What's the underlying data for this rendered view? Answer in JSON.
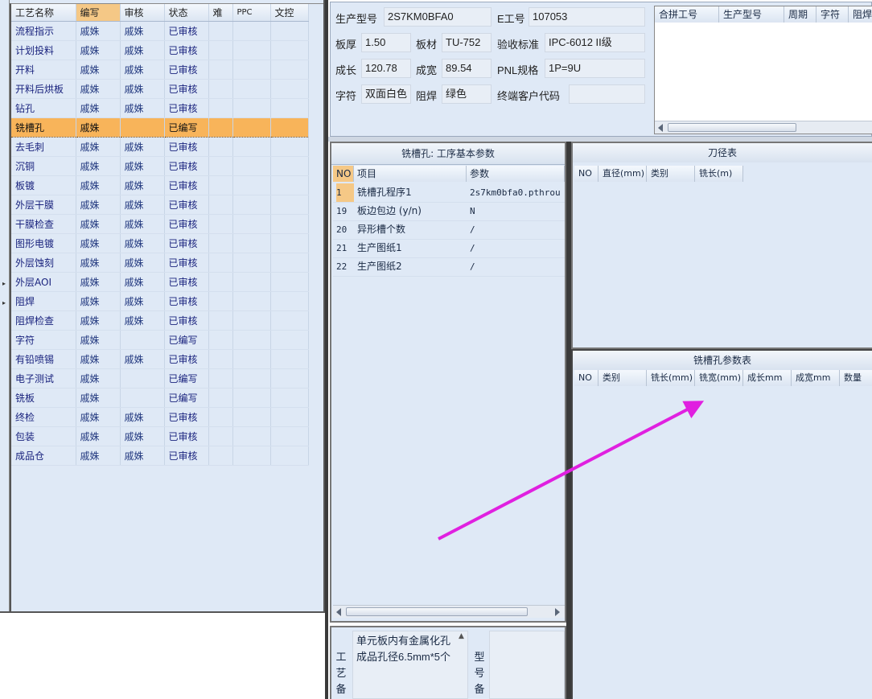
{
  "process_grid": {
    "columns": [
      "工艺名称",
      "编写",
      "审核",
      "状态",
      "难",
      "PPC",
      "文控"
    ],
    "rows": [
      {
        "name": "流程指示",
        "editor": "戚姝",
        "reviewer": "戚姝",
        "status": "已审核"
      },
      {
        "name": "计划投料",
        "editor": "戚姝",
        "reviewer": "戚姝",
        "status": "已审核"
      },
      {
        "name": "开料",
        "editor": "戚姝",
        "reviewer": "戚姝",
        "status": "已审核"
      },
      {
        "name": "开料后烘板",
        "editor": "戚姝",
        "reviewer": "戚姝",
        "status": "已审核"
      },
      {
        "name": "钻孔",
        "editor": "戚姝",
        "reviewer": "戚姝",
        "status": "已审核"
      },
      {
        "name": "铣槽孔",
        "editor": "戚姝",
        "reviewer": "",
        "status": "已编写"
      },
      {
        "name": "去毛刺",
        "editor": "戚姝",
        "reviewer": "戚姝",
        "status": "已审核"
      },
      {
        "name": "沉铜",
        "editor": "戚姝",
        "reviewer": "戚姝",
        "status": "已审核"
      },
      {
        "name": "板镀",
        "editor": "戚姝",
        "reviewer": "戚姝",
        "status": "已审核"
      },
      {
        "name": "外层干膜",
        "editor": "戚姝",
        "reviewer": "戚姝",
        "status": "已审核"
      },
      {
        "name": "干膜检查",
        "editor": "戚姝",
        "reviewer": "戚姝",
        "status": "已审核"
      },
      {
        "name": "图形电镀",
        "editor": "戚姝",
        "reviewer": "戚姝",
        "status": "已审核"
      },
      {
        "name": "外层蚀刻",
        "editor": "戚姝",
        "reviewer": "戚姝",
        "status": "已审核"
      },
      {
        "name": "外层AOI",
        "editor": "戚姝",
        "reviewer": "戚姝",
        "status": "已审核"
      },
      {
        "name": "阻焊",
        "editor": "戚姝",
        "reviewer": "戚姝",
        "status": "已审核"
      },
      {
        "name": "阻焊检查",
        "editor": "戚姝",
        "reviewer": "戚姝",
        "status": "已审核"
      },
      {
        "name": "字符",
        "editor": "戚姝",
        "reviewer": "",
        "status": "已编写"
      },
      {
        "name": "有铅喷锡",
        "editor": "戚姝",
        "reviewer": "戚姝",
        "status": "已审核"
      },
      {
        "name": "电子测试",
        "editor": "戚姝",
        "reviewer": "",
        "status": "已编写"
      },
      {
        "name": "铣板",
        "editor": "戚姝",
        "reviewer": "",
        "status": "已编写"
      },
      {
        "name": "终检",
        "editor": "戚姝",
        "reviewer": "戚姝",
        "status": "已审核"
      },
      {
        "name": "包装",
        "editor": "戚姝",
        "reviewer": "戚姝",
        "status": "已审核"
      },
      {
        "name": "成品仓",
        "editor": "戚姝",
        "reviewer": "戚姝",
        "status": "已审核"
      }
    ]
  },
  "info": {
    "model_label": "生产型号",
    "model_value": "2S7KM0BFA0",
    "eno_label": "E工号",
    "eno_value": "107053",
    "thickness_label": "板厚",
    "thickness_value": "1.50",
    "material_label": "板材",
    "material_value": "TU-752",
    "standard_label": "验收标准",
    "standard_value": "IPC-6012 II级",
    "length_label": "成长",
    "length_value": "120.78",
    "width_label": "成宽",
    "width_value": "89.54",
    "pnl_label": "PNL规格",
    "pnl_value": "1P=9U",
    "legend_label": "字符",
    "legend_value": "双面白色",
    "mask_label": "阻焊",
    "mask_value": "绿色",
    "customer_code_label": "终端客户代码",
    "customer_code_value": ""
  },
  "merge_grid": {
    "columns": [
      "合拼工号",
      "生产型号",
      "周期",
      "字符",
      "阻焊"
    ]
  },
  "params": {
    "title": "铣槽孔: 工序基本参数",
    "columns": [
      "NO",
      "项目",
      "参数"
    ],
    "rows": [
      {
        "no": "1",
        "item": "铣槽孔程序1",
        "value": "2s7km0bfa0.pthrou"
      },
      {
        "no": "19",
        "item": "板边包边 (y/n)",
        "value": "N"
      },
      {
        "no": "20",
        "item": "异形槽个数",
        "value": "/"
      },
      {
        "no": "21",
        "item": "生产图纸1",
        "value": "/"
      },
      {
        "no": "22",
        "item": "生产图纸2",
        "value": "/"
      }
    ]
  },
  "remarks": {
    "process_label_chars": [
      "工",
      "艺",
      "备"
    ],
    "process_text": "单元板内有金属化孔成品孔径6.5mm*5个",
    "model_label_chars": [
      "型",
      "号",
      "备"
    ]
  },
  "cutter_table": {
    "title": "刀径表",
    "columns": [
      "NO",
      "直径(mm)",
      "类别",
      "铣长(m)"
    ]
  },
  "mill_table": {
    "title": "铣槽孔参数表",
    "columns": [
      "NO",
      "类别",
      "铣长(mm)",
      "铣宽(mm)",
      "成长mm",
      "成宽mm",
      "数量"
    ]
  },
  "colors": {
    "selected_row": "#f8b45a",
    "panel_bg": "#dfe9f6",
    "annotation_arrow": "#e020e0"
  }
}
